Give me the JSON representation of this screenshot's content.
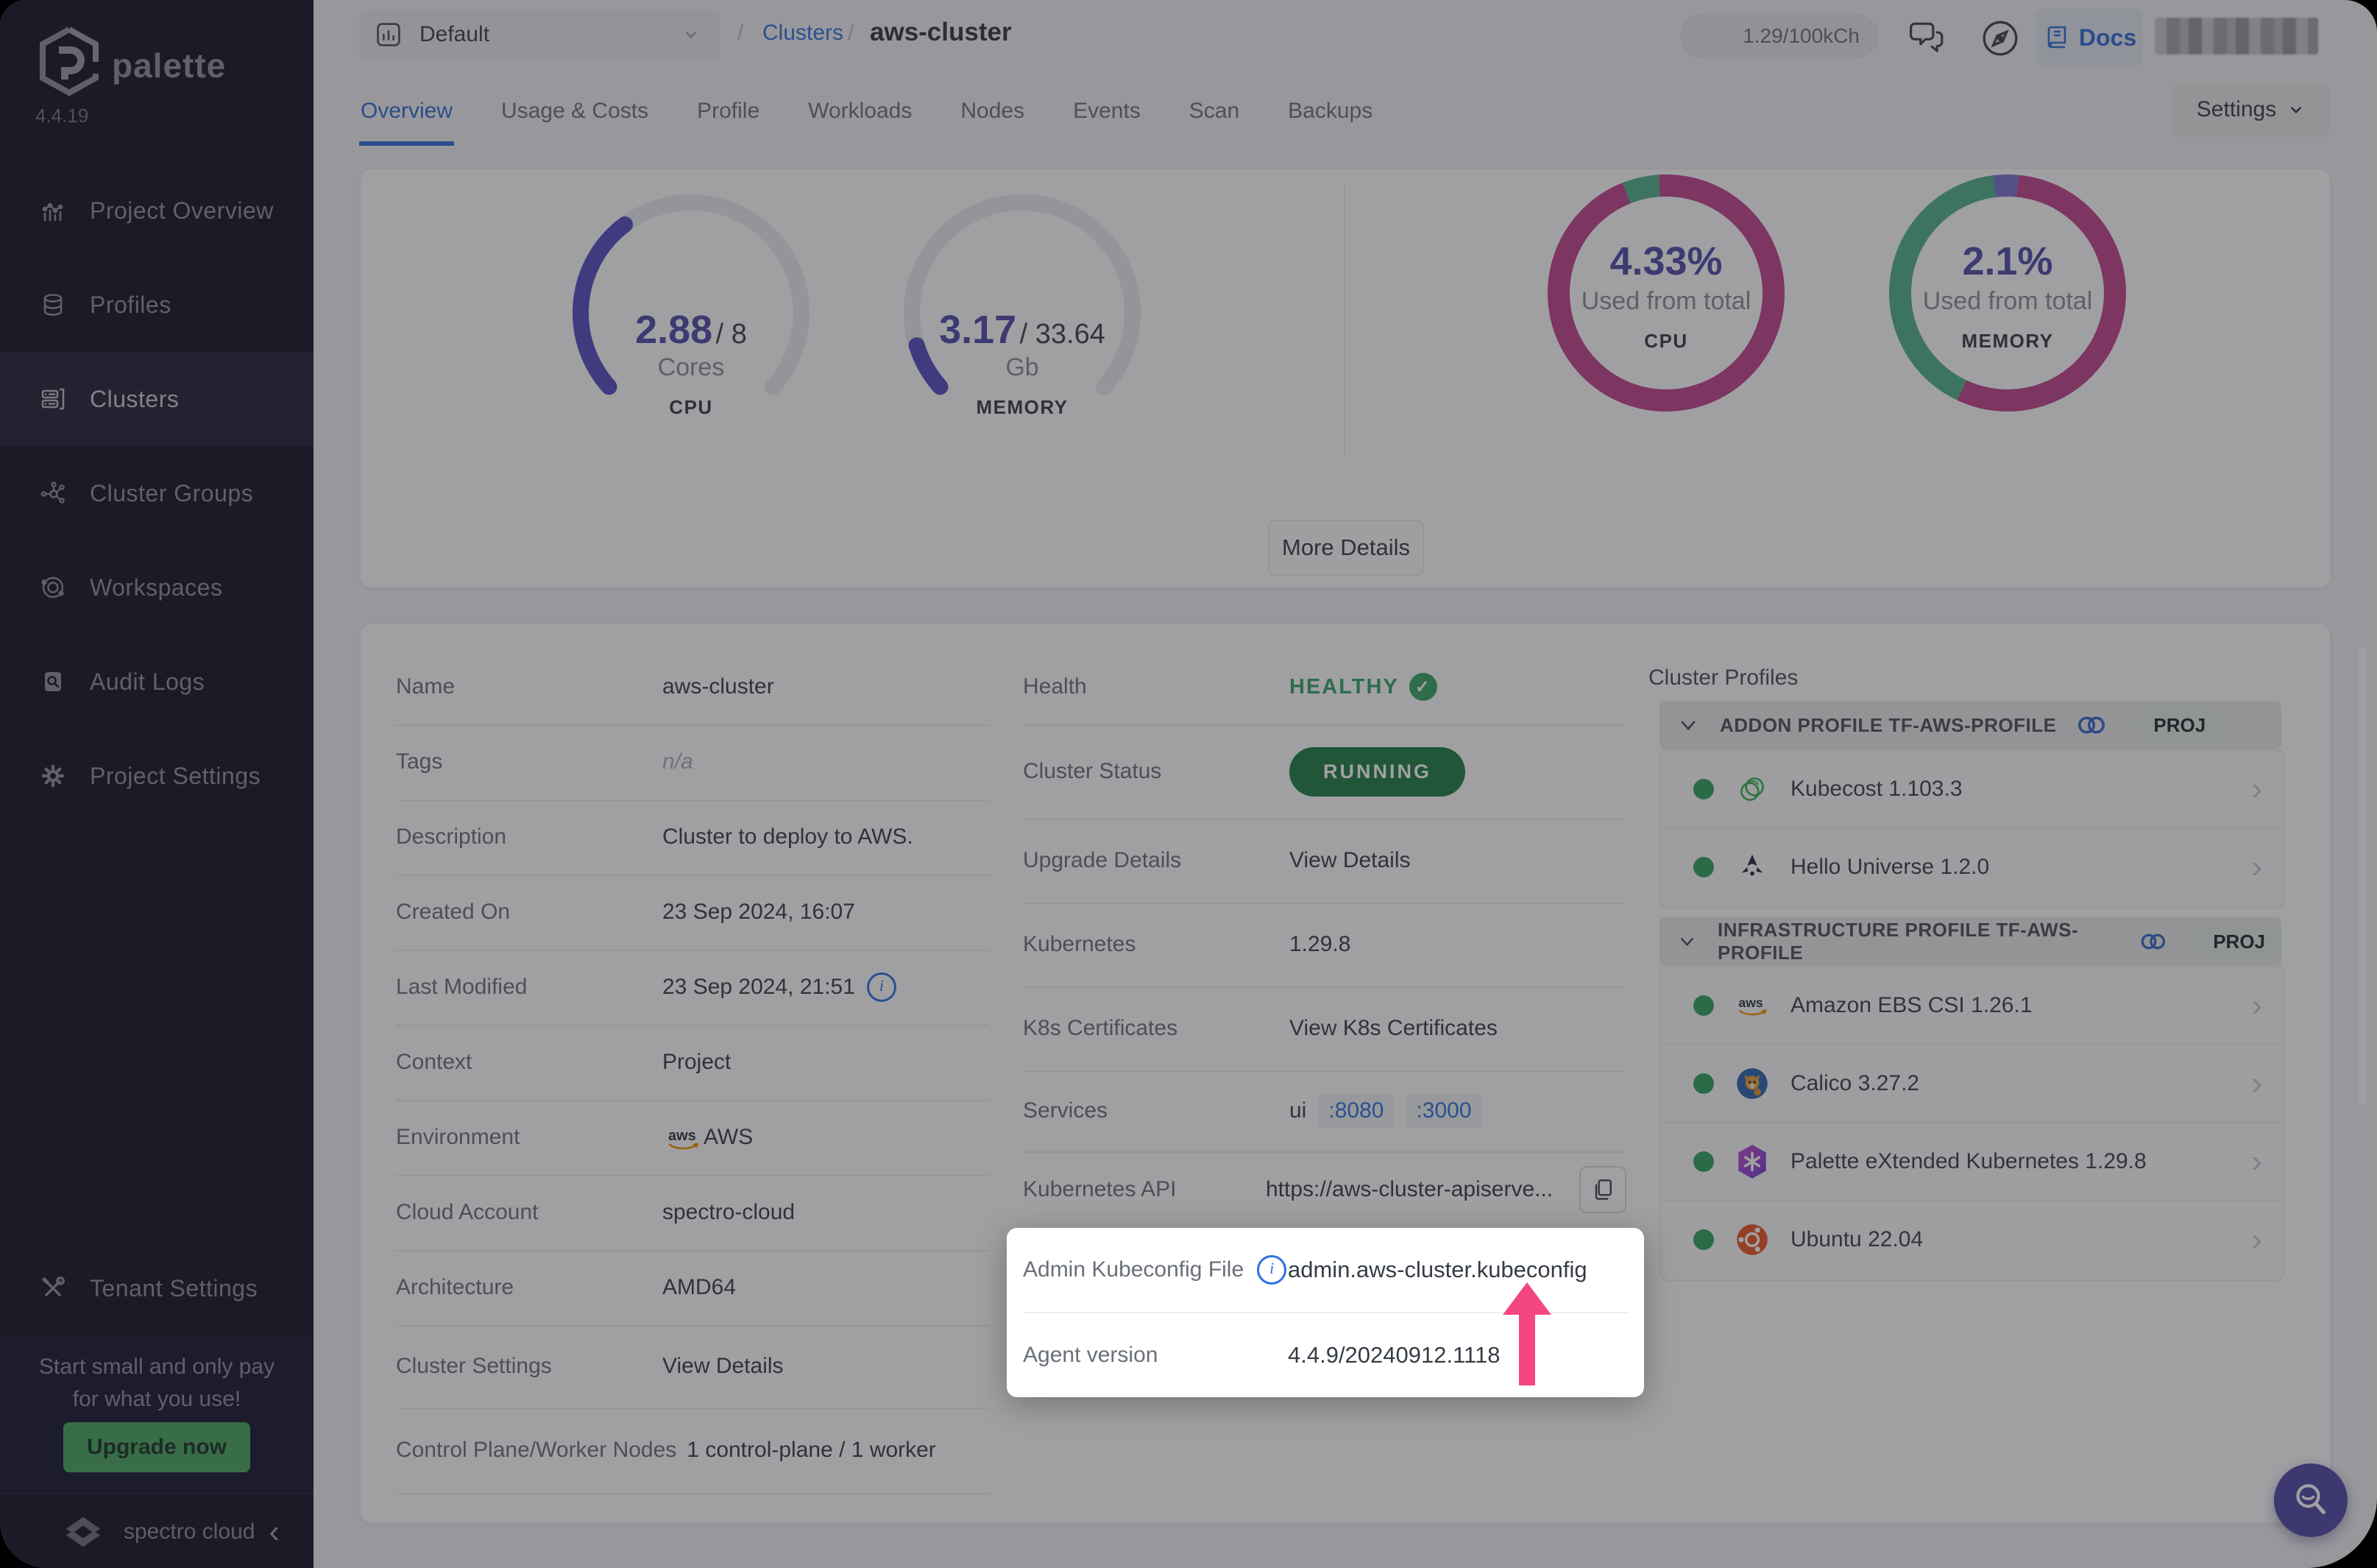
{
  "colors": {
    "accent_blue": "#2E6BD6",
    "link_blue": "#2E71E0",
    "magenta": "#C0408E",
    "green": "#4FB08A",
    "indigo": "#554CC0",
    "status_green": "#1E7C45",
    "healthy_green": "#35A266",
    "arrow_pink": "#F4477F",
    "upgrade_green": "#46A55F"
  },
  "sidebar": {
    "logo_text": "palette",
    "version": "4.4.19",
    "items": [
      {
        "label": "Project Overview",
        "icon": "chart-icon"
      },
      {
        "label": "Profiles",
        "icon": "layers-icon"
      },
      {
        "label": "Clusters",
        "icon": "server-icon"
      },
      {
        "label": "Cluster Groups",
        "icon": "nodes-icon"
      },
      {
        "label": "Workspaces",
        "icon": "orbit-icon"
      },
      {
        "label": "Audit Logs",
        "icon": "audit-icon"
      },
      {
        "label": "Project Settings",
        "icon": "gear-icon"
      }
    ],
    "active_index": 2,
    "tenant_settings": "Tenant Settings",
    "promo": {
      "line1": "Start small and only pay",
      "line2": "for what you use!",
      "button": "Upgrade now"
    },
    "footer": {
      "brand": "spectro cloud"
    }
  },
  "topbar": {
    "project_selector": "Default",
    "breadcrumb": {
      "separator": "/",
      "section": "Clusters",
      "current": "aws-cluster"
    },
    "usage_pill": "1.29/100kCh",
    "docs": "Docs"
  },
  "tabs": {
    "items": [
      "Overview",
      "Usage & Costs",
      "Profile",
      "Workloads",
      "Nodes",
      "Events",
      "Scan",
      "Backups"
    ],
    "active_index": 0,
    "settings_button": "Settings"
  },
  "hero": {
    "more_details_button": "More Details"
  },
  "chart_data": [
    {
      "type": "gauge",
      "title": "CPU",
      "value": 2.88,
      "max": 8,
      "unit": "Cores",
      "value_label": "2.88",
      "max_label": "/ 8",
      "color": "#554CC0",
      "track": "#EAEAEF"
    },
    {
      "type": "gauge",
      "title": "MEMORY",
      "value": 3.17,
      "max": 33.64,
      "unit": "Gb",
      "value_label": "3.17",
      "max_label": "/ 33.64",
      "color": "#554CC0",
      "track": "#EAEAEF"
    },
    {
      "type": "donut",
      "title": "CPU",
      "percent": 4.33,
      "percent_label": "4.33%",
      "subtitle": "Used from total",
      "start_pct": -6,
      "segments": [
        {
          "name": "free",
          "pct": 5,
          "color": "#4FB08A"
        },
        {
          "name": "used",
          "pct": 95,
          "color": "#C0408E"
        }
      ]
    },
    {
      "type": "donut",
      "title": "MEMORY",
      "percent": 2.1,
      "percent_label": "2.1%",
      "subtitle": "Used from total",
      "start_pct": -2,
      "segments": [
        {
          "name": "other",
          "pct": 3.5,
          "color": "#7A6FD0"
        },
        {
          "name": "used",
          "pct": 55.5,
          "color": "#C0408E"
        },
        {
          "name": "free",
          "pct": 41,
          "color": "#4FB08A"
        }
      ]
    }
  ],
  "details": {
    "left": [
      {
        "label": "Name",
        "value": "aws-cluster"
      },
      {
        "label": "Tags",
        "value": "n/a"
      },
      {
        "label": "Description",
        "value": "Cluster to deploy to AWS."
      },
      {
        "label": "Created On",
        "value": "23 Sep 2024, 16:07"
      },
      {
        "label": "Last Modified",
        "value": "23 Sep 2024, 21:51"
      },
      {
        "label": "Context",
        "value": "Project"
      },
      {
        "label": "Environment",
        "value": "AWS"
      },
      {
        "label": "Cloud Account",
        "value": "spectro-cloud"
      },
      {
        "label": "Architecture",
        "value": "AMD64"
      },
      {
        "label": "Cluster Settings",
        "value": "View Details"
      },
      {
        "label": "Control Plane/Worker Nodes",
        "value": "1 control-plane / 1 worker"
      }
    ],
    "middle": [
      {
        "label": "Health",
        "value": "HEALTHY"
      },
      {
        "label": "Cluster Status",
        "value": "RUNNING"
      },
      {
        "label": "Upgrade Details",
        "value": "View Details"
      },
      {
        "label": "Kubernetes",
        "value": "1.29.8"
      },
      {
        "label": "K8s Certificates",
        "value": "View K8s Certificates"
      },
      {
        "label": "Services",
        "value": "ui",
        "ports": [
          ":8080",
          ":3000"
        ]
      },
      {
        "label": "Kubernetes API",
        "value": "https://aws-cluster-apiserve..."
      }
    ]
  },
  "spotlight": {
    "rows": [
      {
        "label": "Admin Kubeconfig File",
        "value": "admin.aws-cluster.kubeconfig"
      },
      {
        "label": "Agent version",
        "value": "4.4.9/20240912.1118"
      }
    ]
  },
  "cluster_profiles": {
    "title": "Cluster Profiles",
    "badge": "PROJ",
    "sections": [
      {
        "header": "ADDON PROFILE TF-AWS-PROFILE",
        "items": [
          {
            "name": "Kubecost 1.103.3",
            "icon": "kubecost-icon"
          },
          {
            "name": "Hello Universe 1.2.0",
            "icon": "hello-universe-icon"
          }
        ]
      },
      {
        "header": "INFRASTRUCTURE PROFILE TF-AWS-PROFILE",
        "items": [
          {
            "name": "Amazon EBS CSI 1.26.1",
            "icon": "aws-icon"
          },
          {
            "name": "Calico 3.27.2",
            "icon": "calico-icon"
          },
          {
            "name": "Palette eXtended Kubernetes 1.29.8",
            "icon": "pxk-icon"
          },
          {
            "name": "Ubuntu 22.04",
            "icon": "ubuntu-icon"
          }
        ]
      }
    ]
  }
}
